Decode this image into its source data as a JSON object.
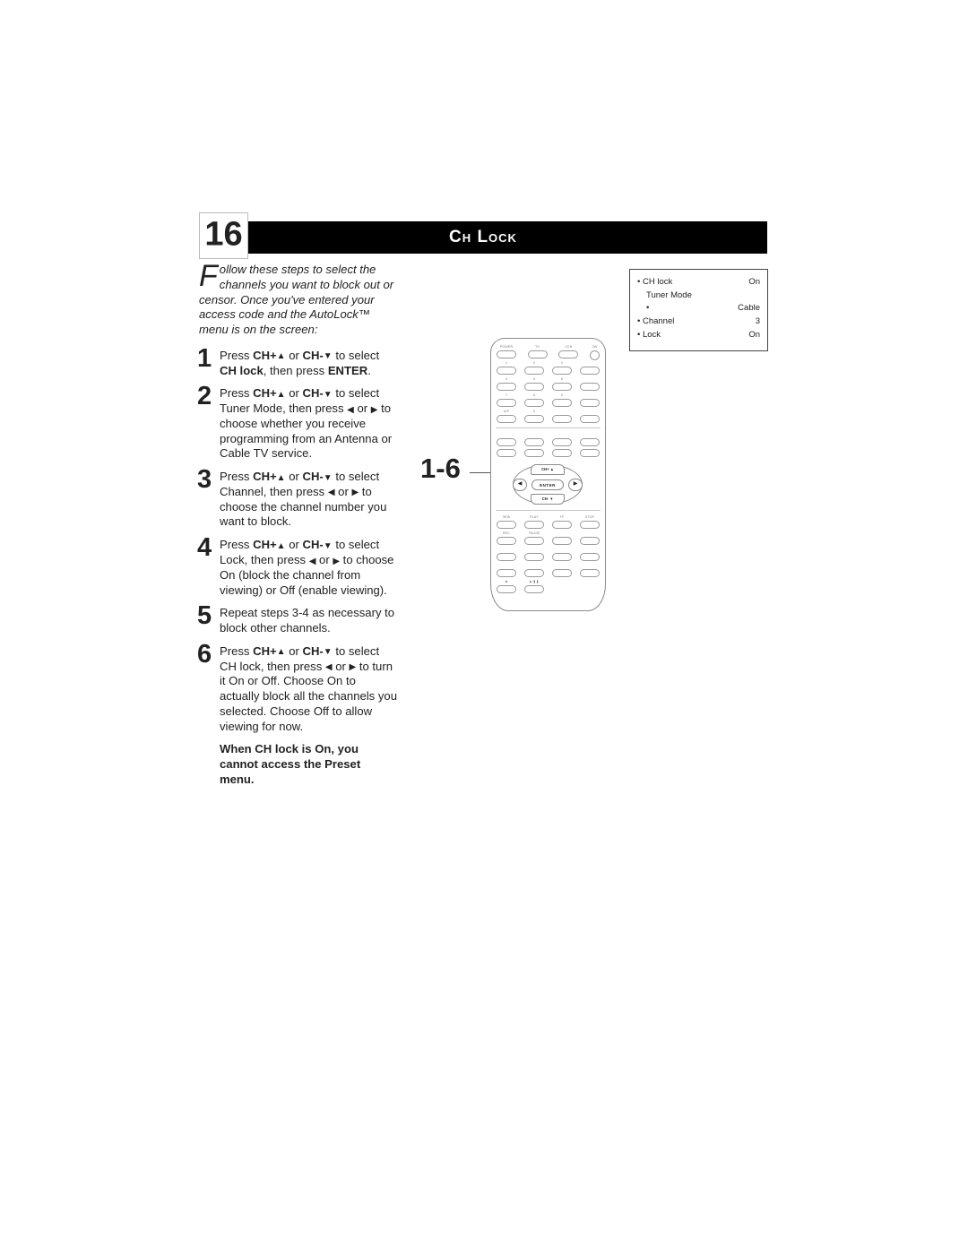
{
  "header": {
    "page_number": "16",
    "title": "Ch Lock"
  },
  "intro": {
    "dropcap": "F",
    "text_line1": "ollow these steps to select the channels you want to block out or censor.",
    "text_line2": "Once you've entered your access code and the AutoLock™ menu is on the screen:"
  },
  "glyphs": {
    "up": "▲",
    "down": "▼",
    "left": "◀",
    "right": "▶"
  },
  "steps": [
    {
      "num": "1",
      "html": "Press <b>CH+<span class='tri-up'>▲</span></b> or <b>CH-<span class='tri-down'>▼</span></b> to select <b>CH lock</b>, then press <b>ENTER</b>."
    },
    {
      "num": "2",
      "html": "Press <b>CH+<span class='tri-up'>▲</span></b> or <b>CH-<span class='tri-down'>▼</span></b> to select Tuner Mode, then press <span class='tri-left'>◀</span> or <span class='tri-right'>▶</span> to choose whether you receive programming from an Antenna or Cable TV service."
    },
    {
      "num": "3",
      "html": "Press <b>CH+<span class='tri-up'>▲</span></b> or <b>CH-<span class='tri-down'>▼</span></b> to select Channel, then press <span class='tri-left'>◀</span> or <span class='tri-right'>▶</span> to choose the channel number you want to block."
    },
    {
      "num": "4",
      "html": "Press <b>CH+<span class='tri-up'>▲</span></b> or <b>CH-<span class='tri-down'>▼</span></b> to select Lock, then press <span class='tri-left'>◀</span> or <span class='tri-right'>▶</span> to choose On (block the channel from viewing) or Off (enable viewing)."
    },
    {
      "num": "5",
      "html": "Repeat steps 3-4 as necessary to block other channels."
    },
    {
      "num": "6",
      "html": "Press <b>CH+<span class='tri-up'>▲</span></b> or <b>CH-<span class='tri-down'>▼</span></b> to select CH lock, then press <span class='tri-left'>◀</span> or <span class='tri-right'>▶</span> to turn it On or Off. Choose On to actually block all the channels you selected. Choose Off to allow viewing for now."
    }
  ],
  "note": "When CH lock is On, you cannot access the Preset menu.",
  "callout": "1-6",
  "osd": {
    "rows": [
      {
        "bullet": "•",
        "label": "CH lock",
        "value": "On",
        "indent": 0
      },
      {
        "bullet": "",
        "label": "Tuner Mode",
        "value": "",
        "indent": 1
      },
      {
        "bullet": "•",
        "label": "",
        "value": "Cable",
        "indent": 1
      },
      {
        "bullet": "•",
        "label": "Channel",
        "value": "3",
        "indent": 0
      },
      {
        "bullet": "•",
        "label": "Lock",
        "value": "On",
        "indent": 0
      }
    ]
  },
  "remote": {
    "top_labels": [
      "POWER",
      "TV",
      "VCR",
      "ON"
    ],
    "row1_labels": [
      "1",
      "2",
      "3",
      ""
    ],
    "row2_labels": [
      "4",
      "5",
      "6",
      ""
    ],
    "row3_labels": [
      "7",
      "8",
      "9",
      ""
    ],
    "row4_labels": [
      "A/P",
      "0",
      "",
      ""
    ],
    "mid_labels": [
      "",
      "",
      "",
      ""
    ],
    "ch_up": "CH+ ▲",
    "enter": "ENTER",
    "ch_dn": "CH- ▼",
    "left": "◀",
    "right": "▶",
    "bot1_labels": [
      "REW",
      "PLAY",
      "FF",
      "STOP"
    ],
    "bot2_labels": [
      "REC",
      "PAUSE",
      "",
      ""
    ],
    "bot3_labels": [
      "",
      "",
      "",
      ""
    ],
    "bot4_labels": [
      "",
      "",
      "",
      ""
    ],
    "bot5_labels": [
      "■",
      "▶/❚❚",
      "",
      ""
    ]
  }
}
